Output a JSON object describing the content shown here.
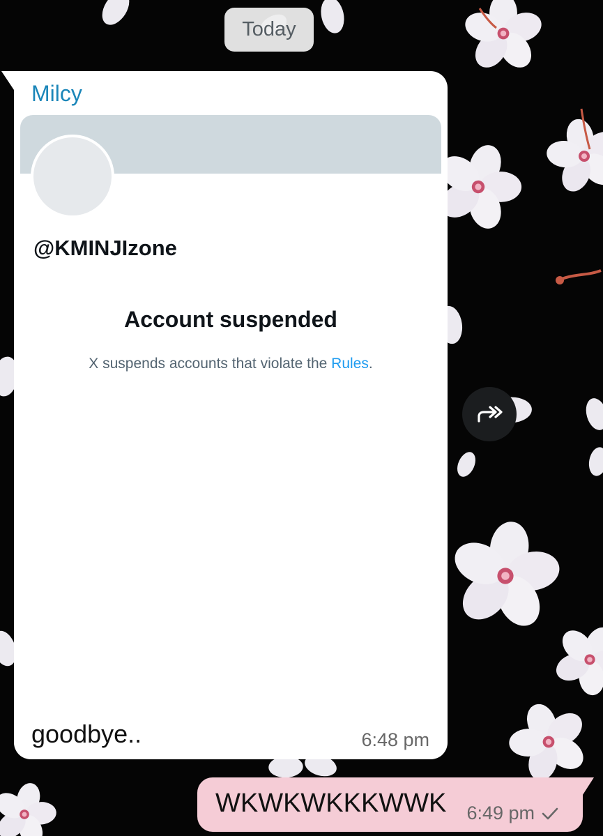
{
  "date_separator": "Today",
  "messages": {
    "incoming": {
      "sender": "Milcy",
      "profile_card": {
        "handle": "@KMINJIzone",
        "title": "Account suspended",
        "description_prefix": "X suspends accounts that violate the ",
        "rules_link": "Rules",
        "description_suffix": "."
      },
      "caption": "goodbye..",
      "time": "6:48 pm"
    },
    "outgoing": {
      "text": "WKWKWKKKWWK",
      "time": "6:49 pm",
      "status_icon": "single-check-icon"
    }
  },
  "actions": {
    "forward_icon": "forward-icon"
  },
  "colors": {
    "wallpaper": "#050505",
    "sender_name": "#1b86b9",
    "link": "#1d9bf0",
    "banner": "#cfd9de",
    "outgoing_bubble": "#f5ccd6"
  }
}
